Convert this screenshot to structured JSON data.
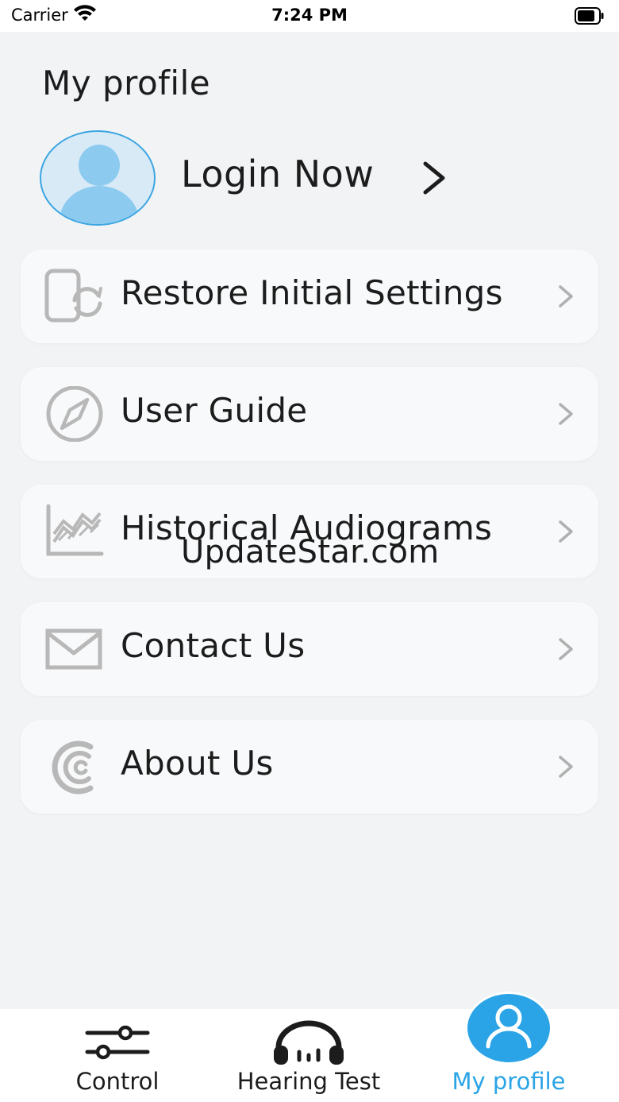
{
  "status_bar": {
    "carrier": "Carrier",
    "time": "7:24 PM"
  },
  "page": {
    "title": "My profile"
  },
  "profile": {
    "login_label": "Login Now"
  },
  "menu": {
    "items": [
      {
        "label": "Restore Initial Settings",
        "icon": "phone-reset-icon"
      },
      {
        "label": "User Guide",
        "icon": "compass-icon"
      },
      {
        "label": "Historical Audiograms",
        "icon": "chart-icon"
      },
      {
        "label": "Contact Us",
        "icon": "mail-icon"
      },
      {
        "label": "About Us",
        "icon": "brand-logo-icon"
      }
    ]
  },
  "watermark": "UpdateStar.com",
  "tab_bar": {
    "tabs": [
      {
        "label": "Control",
        "icon": "sliders-icon"
      },
      {
        "label": "Hearing Test",
        "icon": "headphones-icon"
      },
      {
        "label": "My profile",
        "icon": "user-icon",
        "active": true
      }
    ]
  },
  "colors": {
    "accent": "#2aa4e6",
    "background": "#f2f3f5",
    "card": "#f8f9fa",
    "icon_gray": "#b8b8b8",
    "avatar_fill": "#8ccbef"
  }
}
